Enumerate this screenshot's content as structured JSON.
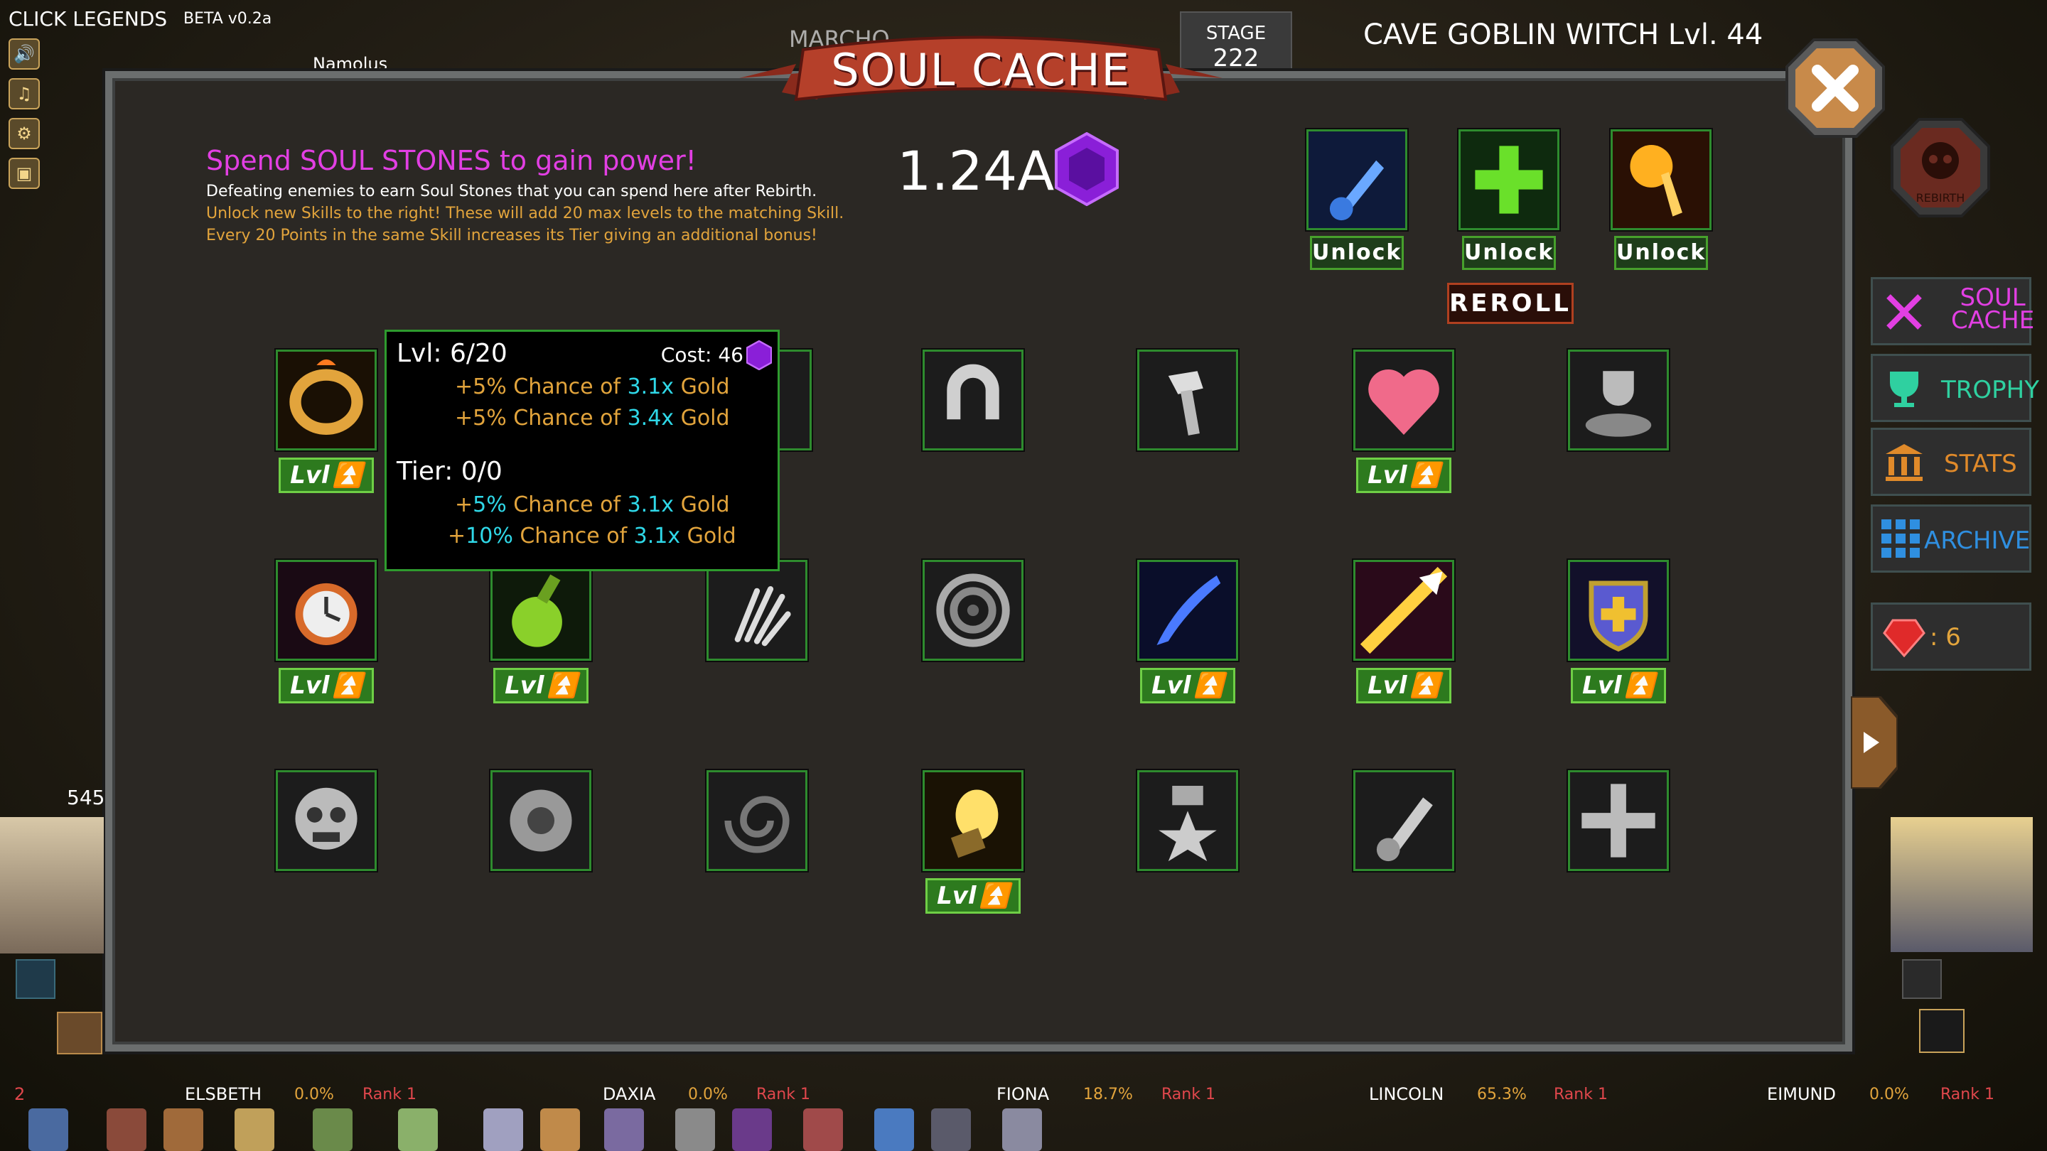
{
  "app": {
    "title": "CLICK LEGENDS",
    "version": "BETA v0.2a"
  },
  "top": {
    "player_name": "Namolus",
    "stage_label": "STAGE",
    "stage_value": "222",
    "enemy_title": "CAVE GOBLIN WITCH Lvl. 44",
    "partial_header": "MARCHO"
  },
  "side_menu": {
    "icons": [
      "speaker-icon",
      "music-note-icon",
      "gear-icon",
      "save-disk-icon"
    ]
  },
  "modal": {
    "title": "SOUL CACHE",
    "headline": "Spend SOUL STONES to gain power!",
    "desc_line1": "Defeating enemies to earn Soul Stones that you can spend here after Rebirth.",
    "desc_line2": "Unlock new Skills to the right! These will add 20 max levels to the matching Skill.",
    "desc_line3": "Every 20 Points in the same Skill increases its Tier giving an additional bonus!",
    "soul_stones": "1.24A",
    "unlock_label": "Unlock",
    "reroll_label": "REROLL",
    "lvl_label": "Lvl",
    "unlock_slots": [
      {
        "icon": "blue-potion-icon"
      },
      {
        "icon": "green-cross-icon"
      },
      {
        "icon": "golden-comet-icon"
      }
    ],
    "grid": [
      {
        "icon": "gold-ring-icon",
        "unlocked": true
      },
      {
        "icon": "claw-icon",
        "unlocked": false
      },
      {
        "icon": "footprints-icon",
        "unlocked": false
      },
      {
        "icon": "magnet-icon",
        "unlocked": false
      },
      {
        "icon": "hammer-icon",
        "unlocked": false
      },
      {
        "icon": "heart-icon",
        "unlocked": true
      },
      {
        "icon": "trophy-coins-icon",
        "unlocked": false
      },
      {
        "icon": "stopwatch-icon",
        "unlocked": true
      },
      {
        "icon": "green-potion-icon",
        "unlocked": true
      },
      {
        "icon": "skeleton-hand-icon",
        "unlocked": false
      },
      {
        "icon": "vortex-icon",
        "unlocked": false
      },
      {
        "icon": "blue-slash-icon",
        "unlocked": true
      },
      {
        "icon": "golden-arrow-icon",
        "unlocked": true
      },
      {
        "icon": "holy-shield-icon",
        "unlocked": true
      },
      {
        "icon": "skull-mask-icon",
        "unlocked": false
      },
      {
        "icon": "eye-orb-icon",
        "unlocked": false
      },
      {
        "icon": "dark-swirl-icon",
        "unlocked": false
      },
      {
        "icon": "golden-lantern-icon",
        "unlocked": true
      },
      {
        "icon": "star-medal-icon",
        "unlocked": false
      },
      {
        "icon": "grey-potion-icon",
        "unlocked": false
      },
      {
        "icon": "grey-cross-icon",
        "unlocked": false
      }
    ]
  },
  "tooltip": {
    "lvl_label": "Lvl:",
    "lvl_value": "6/20",
    "cost_label": "Cost: 46",
    "line1_pre": "+5% Chance of ",
    "line1_mult": "3.1x",
    "line1_post": " Gold",
    "line2_pre": "+5% Chance of ",
    "line2_mult": "3.4x",
    "line2_post": " Gold",
    "tier_label": "Tier:",
    "tier_value": "0/0",
    "tier1_pre": "+",
    "tier1_pct": "5%",
    "tier1_mid": " Chance of ",
    "tier1_mult": "3.1x",
    "tier1_post": " Gold",
    "tier2_pre": "+",
    "tier2_pct": "10%",
    "tier2_mid": " Chance of ",
    "tier2_mult": "3.1x",
    "tier2_post": " Gold"
  },
  "tabs": [
    {
      "label_line1": "SOUL",
      "label_line2": "CACHE",
      "color": "#e23fe3"
    },
    {
      "label": "TROPHY",
      "color": "#2fd0a0"
    },
    {
      "label": "STATS",
      "color": "#e08a2a"
    },
    {
      "label": "ARCHIVE",
      "color": "#2f8fe0"
    }
  ],
  "gems": {
    "count": ": 6"
  },
  "rebirth": {
    "label": "REBIRTH"
  },
  "left_counter": "545",
  "footer": {
    "left_number": "2",
    "heroes": [
      {
        "name": "ELSBETH",
        "pct": "0.0%",
        "rank": "Rank 1"
      },
      {
        "name": "DAXIA",
        "pct": "0.0%",
        "rank": "Rank 1"
      },
      {
        "name": "FIONA",
        "pct": "18.7%",
        "rank": "Rank 1"
      },
      {
        "name": "LINCOLN",
        "pct": "65.3%",
        "rank": "Rank 1"
      },
      {
        "name": "EIMUND",
        "pct": "0.0%",
        "rank": "Rank 1"
      }
    ]
  },
  "colors": {
    "headline": "#e23fe3",
    "gold_text": "#e2a43c",
    "cyan_text": "#2fd8e8",
    "slot_border": "#2e8b2e",
    "lvl_button": "#2d7a1e"
  }
}
